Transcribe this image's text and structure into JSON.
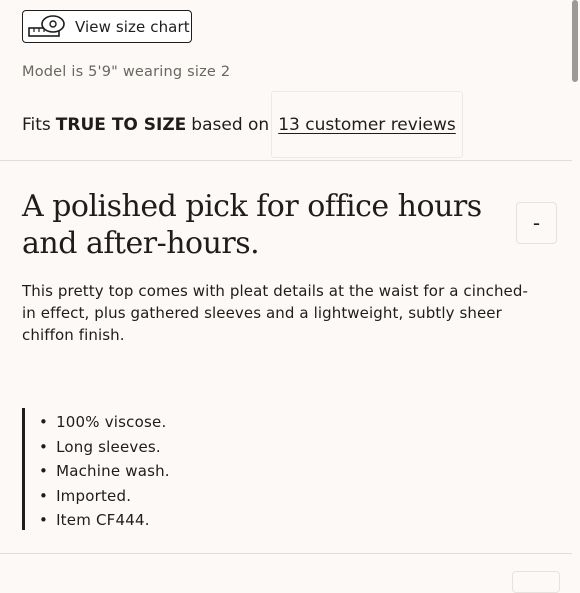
{
  "size_chart": {
    "label": "View size chart",
    "icon": "measuring-tape-icon"
  },
  "model_info": "Model is 5'9\" wearing size 2",
  "fit": {
    "prefix": "Fits",
    "rating": "TRUE TO SIZE",
    "middle": "based on",
    "reviews_link": "13 customer reviews"
  },
  "product": {
    "heading": "A polished pick for office hours and after-hours.",
    "collapse_label": "-",
    "description": "This pretty top comes with pleat details at the waist for a cinched-in effect, plus gathered sleeves and a lightweight, subtly sheer chiffon finish.",
    "details": [
      "100% viscose.",
      "Long sleeves.",
      "Machine wash.",
      "Imported.",
      "Item CF444."
    ]
  },
  "colors": {
    "text": "#1f1d1b",
    "muted_text": "#6a6661",
    "background": "#fcf9f7",
    "divider": "#e2ddd9"
  }
}
